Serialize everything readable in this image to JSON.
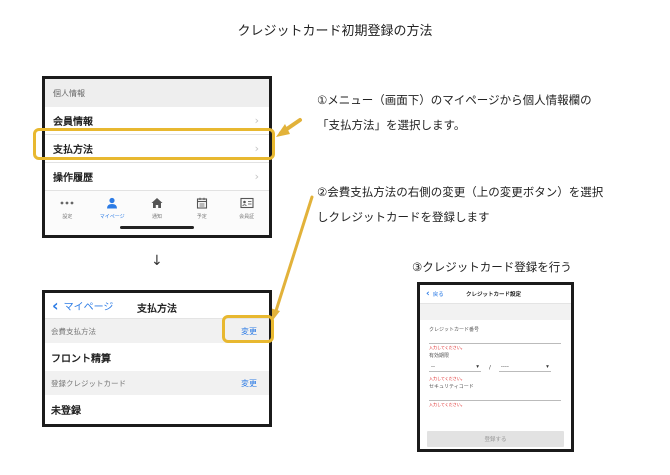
{
  "title": "クレジットカード初期登録の方法",
  "screen1": {
    "header": "個人情報",
    "rows": [
      {
        "label": "会員情報"
      },
      {
        "label": "支払方法"
      },
      {
        "label": "操作履歴"
      }
    ],
    "chevron": "›",
    "tabs": [
      {
        "label": "設定",
        "icon": "more-icon"
      },
      {
        "label": "マイページ",
        "icon": "person-icon"
      },
      {
        "label": "通知",
        "icon": "home-icon"
      },
      {
        "label": "予定",
        "icon": "calendar-icon"
      },
      {
        "label": "会員証",
        "icon": "membership-card-icon"
      }
    ]
  },
  "arrow_down": "↓",
  "steps": {
    "step1_line1": "①メニュー（画面下）のマイページから個人情報欄の",
    "step1_line2": "「支払方法」を選択します。",
    "step2_line1": "②会費支払方法の右側の変更（上の変更ボタン）を選択",
    "step2_line2": "しクレジットカードを登録します",
    "step3": "③クレジットカード登録を行う"
  },
  "screen2": {
    "back_label": "マイページ",
    "title": "支払方法",
    "section1_label": "会費支払方法",
    "section1_action": "変更",
    "row1": "フロント精算",
    "section2_label": "登録クレジットカード",
    "section2_action": "変更",
    "row2": "未登録"
  },
  "screen3": {
    "back_label": "戻る",
    "title": "クレジットカード設定",
    "card_number_label": "クレジットカード番号",
    "card_number_error": "入力してください。",
    "expiry_label": "有効期限",
    "month_placeholder": "--",
    "year_placeholder": "----",
    "expiry_slash": "/",
    "expiry_error": "入力してください。",
    "security_code_label": "セキュリティコード",
    "security_code_error": "入力してください。",
    "submit_label": "登録する"
  },
  "colors": {
    "highlight": "#e8b830",
    "link": "#2c7be5",
    "error": "#dd2222"
  }
}
